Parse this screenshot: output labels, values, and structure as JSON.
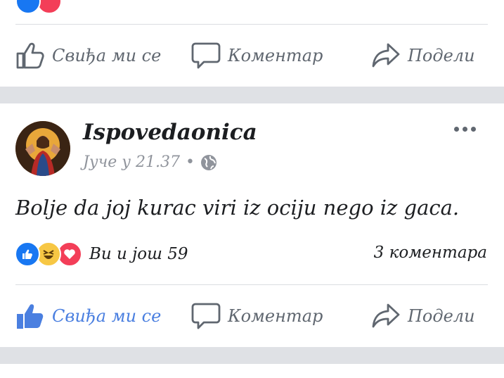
{
  "top_post": {
    "actions": {
      "like": "Свиђа ми се",
      "comment": "Коментар",
      "share": "Подели"
    }
  },
  "post": {
    "page_name": "Ispovedaonica",
    "timestamp": "Јуче у 21.37",
    "separator": "•",
    "privacy_icon": "globe-icon",
    "more_icon": "more-options-icon",
    "text": "Bolje da joj kurac viri iz ociju nego iz gaca.",
    "reactions": {
      "icons": [
        "like-reaction-icon",
        "haha-reaction-icon",
        "love-reaction-icon"
      ],
      "summary": "Ви и још 59"
    },
    "comments_count": "3 коментара",
    "actions": {
      "like": "Свиђа ми се",
      "comment": "Коментар",
      "share": "Подели",
      "like_state": "liked"
    }
  },
  "colors": {
    "liked": "#4a7fe0",
    "icon_gray": "#606770",
    "meta_gray": "#90949c",
    "separator_band": "#dfe1e5",
    "like_blue": "#1877f2",
    "haha_yellow": "#f7c744",
    "love_red": "#f33e58"
  }
}
